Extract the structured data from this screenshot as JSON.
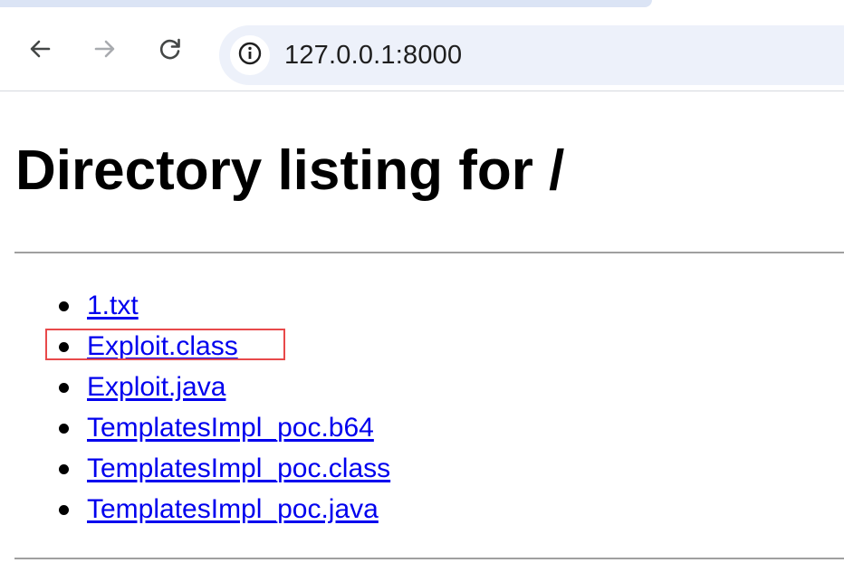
{
  "browser": {
    "address_bar": {
      "url": "127.0.0.1:8000"
    },
    "icons": {
      "back": "back-arrow-icon",
      "forward": "forward-arrow-icon",
      "reload": "reload-icon",
      "site_info": "info-icon"
    },
    "forward_enabled": false
  },
  "page": {
    "title": "Directory listing for /",
    "files": [
      {
        "name": "1.txt"
      },
      {
        "name": "Exploit.class"
      },
      {
        "name": "Exploit.java"
      },
      {
        "name": "TemplatesImpl_poc.b64"
      },
      {
        "name": "TemplatesImpl_poc.class"
      },
      {
        "name": "TemplatesImpl_poc.java"
      }
    ]
  },
  "annotation": {
    "highlighted_item": "Exploit.class",
    "color": "#e8494a"
  },
  "colors": {
    "link": "#0000ee",
    "omnibox_bg": "#edf1fa"
  }
}
